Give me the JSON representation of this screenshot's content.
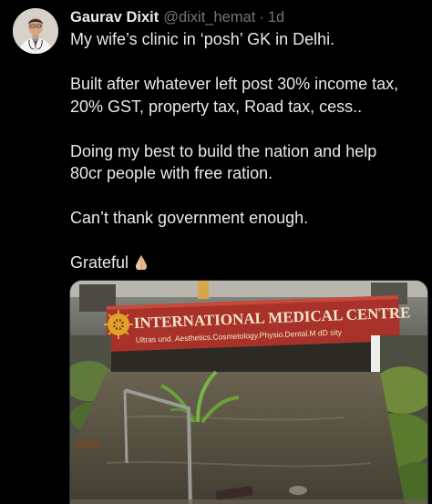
{
  "tweet": {
    "display_name": "Gaurav Dixit",
    "handle": "@dixit_hemat",
    "separator": "·",
    "timestamp": "1d",
    "lines": [
      "My wife’s clinic in ‘posh’ GK in Delhi.",
      "Built after whatever left post 30% income tax,",
      "20% GST, property tax, Road tax, cess..",
      "Doing my best to build the nation and help",
      "80cr people with free ration.",
      "Can’t thank government enough.",
      "Grateful"
    ],
    "grateful_emoji": "folded-hands-emoji"
  },
  "media": {
    "sign_title": "INTERNATIONAL MEDICAL CENTRE",
    "sign_subtitle": "Ultras und. Aesthetics.Cosmetology.Physio.Dental.M dD sity",
    "colors": {
      "sign_red": "#a8322a",
      "water": "#5b5545",
      "sign_text": "#f2e6c8"
    }
  },
  "icons": {
    "avatar": "avatar",
    "emoji": "folded-hands-emoji"
  }
}
